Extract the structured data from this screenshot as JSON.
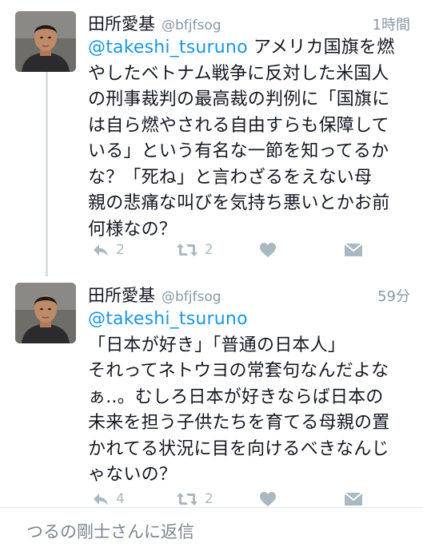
{
  "tweets": [
    {
      "name": "田所愛基",
      "handle": "@bfjfsog",
      "time": "1時間",
      "mention": "@takeshi_tsuruno",
      "lines": [
        "アメリカ国旗を燃",
        "やしたベトナム戦争に反対した米国人",
        "の刑事裁判の最高裁の判例に「国旗に",
        "は自ら燃やされる自由すらも保障して",
        "いる」という有名な一節を知ってるか",
        "な？「死ね」と言わざるをえない母",
        "親の悲痛な叫びを気持ち悪いとかお前",
        "何様なの？"
      ],
      "reply_count": "2",
      "retweet_count": "2"
    },
    {
      "name": "田所愛基",
      "handle": "@bfjfsog",
      "time": "59分",
      "mention": "@takeshi_tsuruno",
      "lines": [
        "「日本が好き」「普通の日本人」",
        "それってネトウヨの常套句なんだよな",
        "ぁ..。むしろ日本が好きならば日本の",
        "未来を担う子供たちを育てる母親の置",
        "かれてる状況に目を向けるべきなんじ",
        "ゃないの？"
      ],
      "reply_count": "4",
      "retweet_count": "2"
    }
  ],
  "reply_bar": {
    "placeholder": "つるの剛士さんに返信"
  },
  "icons": [
    "avatar",
    "reply-icon",
    "retweet-icon",
    "like-icon",
    "direct-message-icon"
  ],
  "colors": {
    "mention": "#1b95e0",
    "muted": "#8899a6",
    "icon": "#aab8c2",
    "divider": "#e1e8ed"
  }
}
